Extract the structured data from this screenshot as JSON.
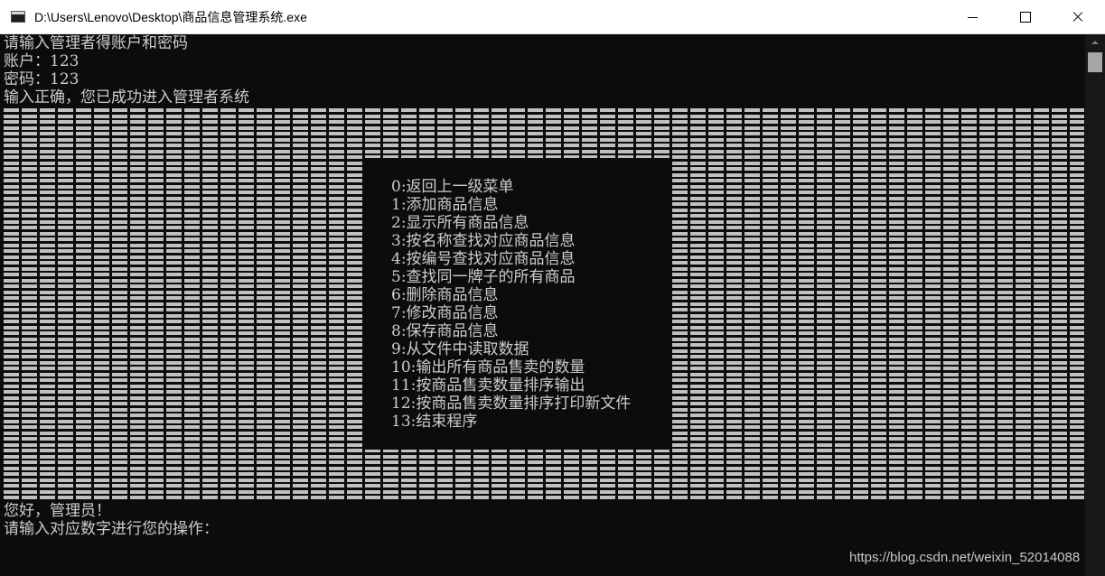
{
  "window": {
    "title": "D:\\Users\\Lenovo\\Desktop\\商品信息管理系统.exe",
    "icon": "console-app-icon"
  },
  "controls": {
    "minimize": "minimize-icon",
    "maximize": "maximize-icon",
    "close": "close-icon"
  },
  "console": {
    "login_prompt": "请输入管理者得账户和密码",
    "account_line": "账户：123",
    "password_line": "密码：123",
    "success_line": "输入正确，您已成功进入管理者系统",
    "greeting": "您好，管理员！",
    "operation_prompt": "请输入对应数字进行您的操作：",
    "text_color": "#cccccc",
    "background_color": "#0c0c0c"
  },
  "menu": {
    "items": [
      "0:返回上一级菜单",
      "1:添加商品信息",
      "2:显示所有商品信息",
      "3:按名称查找对应商品信息",
      "4:按编号查找对应商品信息",
      "5:查找同一牌子的所有商品",
      "6:删除商品信息",
      "7:修改商品信息",
      "8:保存商品信息",
      "9:从文件中读取数据",
      "10:输出所有商品售卖的数量",
      "11:按商品售卖数量排序输出",
      "12:按商品售卖数量排序打印新文件",
      "13:结束程序"
    ]
  },
  "watermark": "https://blog.csdn.net/weixin_52014088"
}
